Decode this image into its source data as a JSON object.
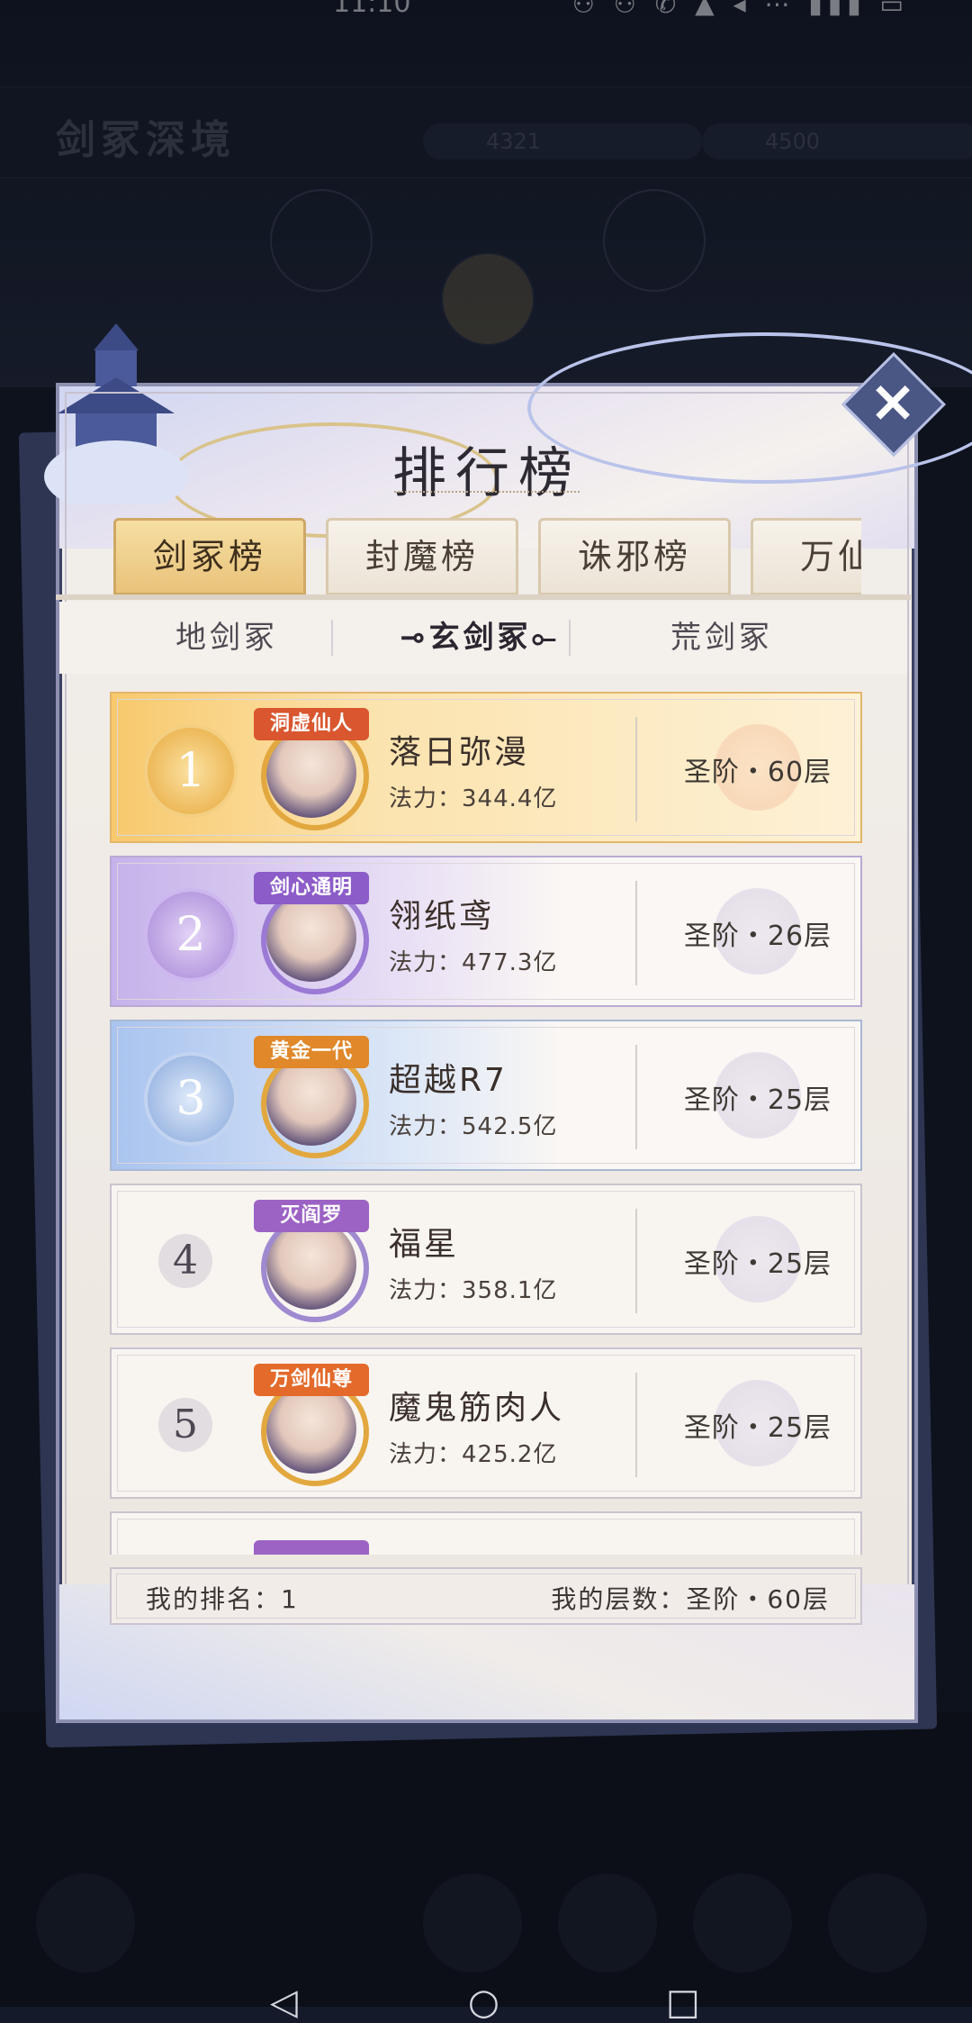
{
  "status_bar": {
    "time": "11:10",
    "icons": "⚇ ⚇ ✆ ▲ ◂ ⋯ ▮▮▮ ▭"
  },
  "background": {
    "title": "剑冢深境",
    "pill_values": [
      "4321",
      "4500"
    ]
  },
  "panel": {
    "title": "排行榜",
    "close_label": "×"
  },
  "tabs": [
    {
      "label": "剑冢榜",
      "active": true
    },
    {
      "label": "封魔榜",
      "active": false
    },
    {
      "label": "诛邪榜",
      "active": false
    },
    {
      "label": "万仙",
      "active": false
    }
  ],
  "subtabs": [
    {
      "label": "地剑冢",
      "active": false
    },
    {
      "label": "⊸玄剑冢⟜",
      "active": true
    },
    {
      "label": "荒剑冢",
      "active": false
    }
  ],
  "ranking": [
    {
      "rank": "1",
      "title_badge": "洞虚仙人",
      "name": "落日弥漫",
      "power": "法力：344.4亿",
      "tier": "圣阶・60层"
    },
    {
      "rank": "2",
      "title_badge": "剑心通明",
      "name": "翎纸鸢",
      "power": "法力：477.3亿",
      "tier": "圣阶・26层"
    },
    {
      "rank": "3",
      "title_badge": "黄金一代",
      "name": "超越R7",
      "power": "法力：542.5亿",
      "tier": "圣阶・25层"
    },
    {
      "rank": "4",
      "title_badge": "灭阎罗",
      "name": "福星",
      "power": "法力：358.1亿",
      "tier": "圣阶・25层"
    },
    {
      "rank": "5",
      "title_badge": "万剑仙尊",
      "name": "魔鬼筋肉人",
      "power": "法力：425.2亿",
      "tier": "圣阶・25层"
    }
  ],
  "my_rank": {
    "label": "我的排名：1",
    "floor": "我的层数：圣阶・60层"
  },
  "colors": {
    "gold": "#f8c96d",
    "purple": "#c5b2ea",
    "blue": "#a9c4ef",
    "panel_border": "#8d8fb0"
  }
}
